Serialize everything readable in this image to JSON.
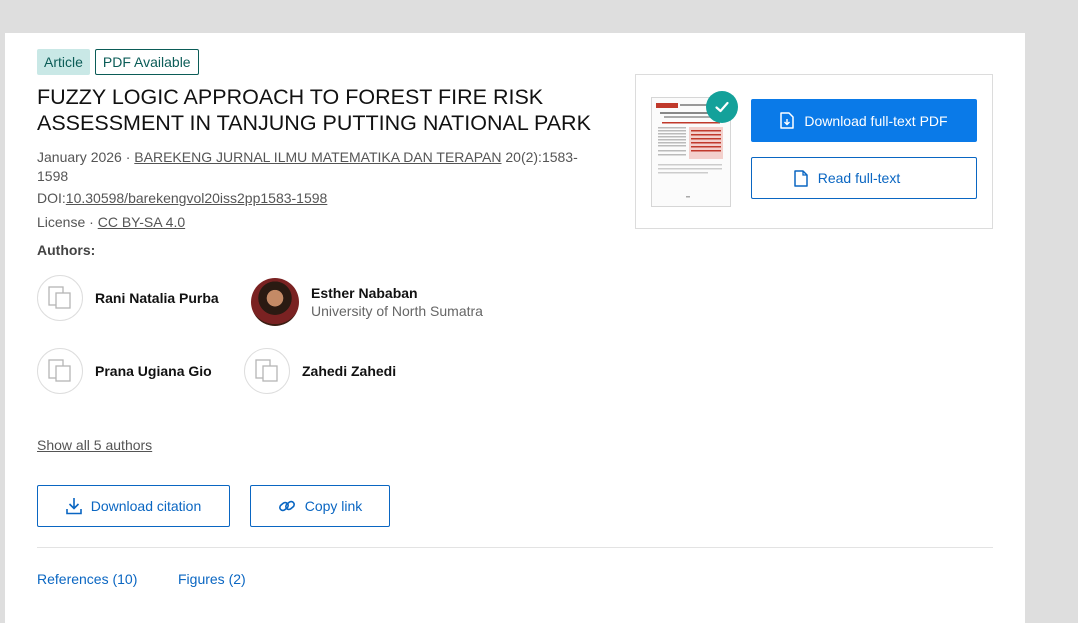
{
  "badges": {
    "article": "Article",
    "pdf": "PDF Available"
  },
  "title": "FUZZY LOGIC APPROACH TO FOREST FIRE RISK ASSESSMENT IN TANJUNG PUTTING NATIONAL PARK",
  "meta": {
    "date": "January 2026",
    "separator": "·",
    "journal": "BAREKENG JURNAL ILMU MATEMATIKA DAN TERAPAN",
    "issue": "20(2):1583-1598",
    "doi_label": "DOI:",
    "doi": "10.30598/barekengvol20iss2pp1583-1598",
    "license_label": "License",
    "license": "CC BY-SA 4.0"
  },
  "authors_label": "Authors:",
  "authors": [
    {
      "name": "Rani Natalia Purba",
      "affiliation": ""
    },
    {
      "name": "Esther Nababan",
      "affiliation": "University of North Sumatra"
    },
    {
      "name": "Prana Ugiana Gio",
      "affiliation": ""
    },
    {
      "name": "Zahedi Zahedi",
      "affiliation": ""
    }
  ],
  "show_all": "Show all 5 authors",
  "actions": {
    "download_citation": "Download citation",
    "copy_link": "Copy link"
  },
  "fulltext": {
    "download_pdf": "Download full-text PDF",
    "read": "Read full-text"
  },
  "tabs": [
    {
      "label": "References (10)"
    },
    {
      "label": "Figures (2)"
    }
  ],
  "colors": {
    "primary": "#0a7ae8",
    "teal": "#14a19a",
    "badge_bg": "#c9e8e6"
  }
}
